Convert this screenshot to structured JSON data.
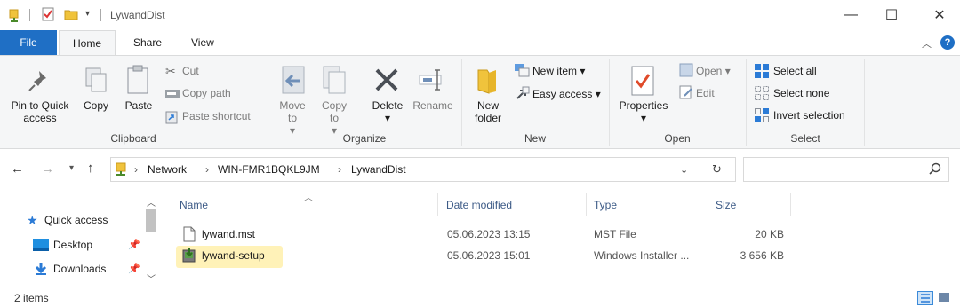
{
  "window": {
    "title": "LywandDist",
    "controls": {
      "minimize": "—",
      "maximize": "☐",
      "close": "✕"
    }
  },
  "tabs": [
    {
      "label": "File"
    },
    {
      "label": "Home"
    },
    {
      "label": "Share"
    },
    {
      "label": "View"
    }
  ],
  "ribbon": {
    "clipboard": {
      "pin": "Pin to Quick access",
      "copy": "Copy",
      "paste": "Paste",
      "cut": "Cut",
      "copy_path": "Copy path",
      "paste_shortcut": "Paste shortcut",
      "group": "Clipboard"
    },
    "organize": {
      "move_to": "Move to",
      "copy_to": "Copy to",
      "delete": "Delete",
      "rename": "Rename",
      "group": "Organize"
    },
    "new": {
      "new_folder": "New folder",
      "new_item": "New item",
      "easy_access": "Easy access",
      "group": "New"
    },
    "open": {
      "properties": "Properties",
      "open": "Open",
      "edit": "Edit",
      "group": "Open"
    },
    "select": {
      "select_all": "Select all",
      "select_none": "Select none",
      "invert": "Invert selection",
      "group": "Select"
    }
  },
  "address": {
    "crumbs": [
      "Network",
      "WIN-FMR1BQKL9JM",
      "LywandDist"
    ],
    "search_placeholder": ""
  },
  "nav_pane": {
    "quick_access": "Quick access",
    "items": [
      {
        "label": "Desktop"
      },
      {
        "label": "Downloads"
      }
    ]
  },
  "columns": {
    "name": "Name",
    "date": "Date modified",
    "type": "Type",
    "size": "Size"
  },
  "files": [
    {
      "name": "lywand.mst",
      "date": "05.06.2023 13:15",
      "type": "MST File",
      "size": "20 KB"
    },
    {
      "name": "lywand-setup",
      "date": "05.06.2023 15:01",
      "type": "Windows Installer ...",
      "size": "3 656 KB"
    }
  ],
  "status": {
    "item_count": "2 items"
  },
  "colors": {
    "file_tab": "#1f6fc5",
    "selection": "#fff2b8",
    "folder": "#f0c33c",
    "accent_blue": "#2b7bd6"
  }
}
